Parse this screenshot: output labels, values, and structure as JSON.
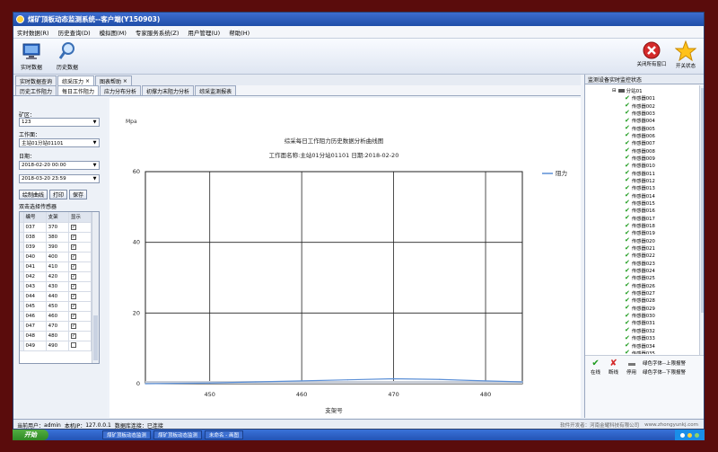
{
  "window": {
    "title": "煤矿顶板动态监测系统--客户端(Y150903)"
  },
  "menu": [
    "实时数据(R)",
    "历史查询(D)",
    "模拟图(M)",
    "专家服务系统(Z)",
    "用户管理(U)",
    "帮助(H)"
  ],
  "toolbar": {
    "realtime_label": "实时数据",
    "history_label": "历史数据",
    "close_all_label": "关闭所有窗口",
    "about_label": "开关状态"
  },
  "tabs_top": [
    "实时数据查询",
    "综采压力",
    "图表帮助"
  ],
  "tabs_sub": [
    "历史工作阻力",
    "每日工作阻力",
    "应力分布分析",
    "初撑力末阻力分析",
    "综采监测报表"
  ],
  "left": {
    "area_label": "矿区：",
    "area_value": "123",
    "face_label": "工作面：",
    "face_value": "主站01分站01101",
    "date_label": "日期：",
    "date_start": "2018-02-20 00:00",
    "date_end": "2018-03-20 23:59",
    "btn_draw": "绘制曲线",
    "btn_print": "打印",
    "btn_save": "保存",
    "sensor_caption": "双击选择传感器",
    "columns": [
      "编号",
      "支架",
      "显示"
    ],
    "rows": [
      {
        "id": "037",
        "support": "370",
        "show": "✓"
      },
      {
        "id": "038",
        "support": "380",
        "show": "✓"
      },
      {
        "id": "039",
        "support": "390",
        "show": "✓"
      },
      {
        "id": "040",
        "support": "400",
        "show": "✓"
      },
      {
        "id": "041",
        "support": "410",
        "show": "✓"
      },
      {
        "id": "042",
        "support": "420",
        "show": "✓"
      },
      {
        "id": "043",
        "support": "430",
        "show": "✓"
      },
      {
        "id": "044",
        "support": "440",
        "show": "✓"
      },
      {
        "id": "045",
        "support": "450",
        "show": "✓"
      },
      {
        "id": "046",
        "support": "460",
        "show": "✓"
      },
      {
        "id": "047",
        "support": "470",
        "show": "✓"
      },
      {
        "id": "048",
        "support": "480",
        "show": "✓"
      },
      {
        "id": "049",
        "support": "490",
        "show": ""
      }
    ]
  },
  "chart_data": {
    "type": "line",
    "title": "综采每日工作阻力历史数据分析曲线图",
    "subtitle": "工作面名称:主站01分站01101  日期:2018-02-20",
    "xlabel": "支架号",
    "ylabel": "Mpa",
    "xlim": [
      443,
      484
    ],
    "ylim": [
      0,
      60
    ],
    "xticks": [
      450,
      460,
      470,
      480
    ],
    "yticks": [
      0,
      20,
      40,
      60
    ],
    "grid": true,
    "legend_position": "top-right",
    "series": [
      {
        "name": "阻力",
        "color": "#5b8fd6",
        "x": [
          443,
          450,
          455,
          460,
          465,
          470,
          475,
          480,
          484
        ],
        "y": [
          0.0,
          0.2,
          0.5,
          0.8,
          1.1,
          1.4,
          1.2,
          0.8,
          0.5
        ]
      }
    ]
  },
  "right": {
    "title": "监测设备实时监控状态",
    "branch": "分站01",
    "sensors": [
      "传感器001",
      "传感器002",
      "传感器003",
      "传感器004",
      "传感器005",
      "传感器006",
      "传感器007",
      "传感器008",
      "传感器009",
      "传感器010",
      "传感器011",
      "传感器012",
      "传感器013",
      "传感器014",
      "传感器015",
      "传感器016",
      "传感器017",
      "传感器018",
      "传感器019",
      "传感器020",
      "传感器021",
      "传感器022",
      "传感器023",
      "传感器024",
      "传感器025",
      "传感器026",
      "传感器027",
      "传感器028",
      "传感器029",
      "传感器030",
      "传感器031",
      "传感器032",
      "传感器033",
      "传感器034",
      "传感器035"
    ],
    "legend": {
      "online": "在线",
      "offline": "断线",
      "stopped": "停用",
      "green_text": "绿色字体--上限报警",
      "blue_text": "绿色字体--下限报警"
    }
  },
  "status": {
    "user_label": "当前用户：",
    "user": "admin",
    "ip_label": "本机IP：",
    "ip": "127.0.0.1",
    "db_label": "数据库连接：",
    "db": "已连接",
    "vendor": "软件开发者：河南金耀科技有限公司",
    "site": "www.zhongyunkj.com"
  },
  "taskbar": {
    "start": "开始",
    "tasks": [
      "煤矿顶板动态监测",
      "煤矿顶板动态监测",
      "未命名 - 画图"
    ]
  }
}
